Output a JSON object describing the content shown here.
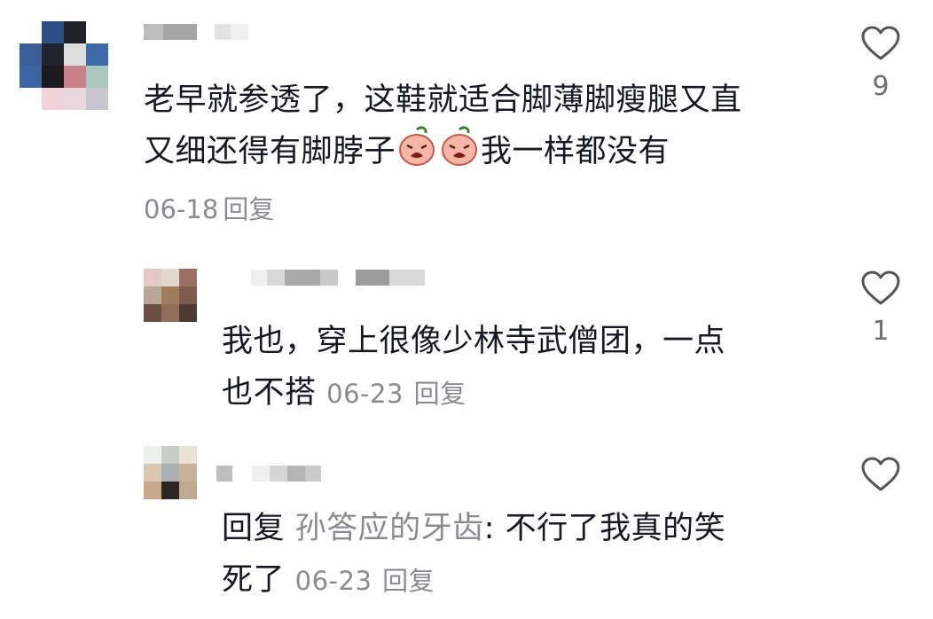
{
  "comments": [
    {
      "text_line1": "老早就参透了，这鞋就适合脚薄脚瘦腿又直",
      "text_line2_before": "又细还得有脚脖子",
      "text_line2_after": "我一样都没有",
      "emojis": [
        "crying-peach-emoji",
        "crying-peach-emoji"
      ],
      "date": "06-18",
      "reply_label": "回复",
      "likes": "9"
    },
    {
      "text_line1": "我也，穿上很像少林寺武僧团，一点",
      "text_line2": "也不搭",
      "date": "06-23",
      "reply_label": "回复",
      "likes": "1"
    },
    {
      "reply_prefix": "回复",
      "mention": "孙答应的牙齿",
      "text_after": ": 不行了我真的笑",
      "text_line2": "死了",
      "date": "06-23",
      "reply_label": "回复",
      "likes": ""
    }
  ],
  "colors": {
    "text": "#161823",
    "meta": "#8a8b91",
    "heart_outline": "#555555"
  },
  "icons": [
    "heart-outline-icon"
  ]
}
